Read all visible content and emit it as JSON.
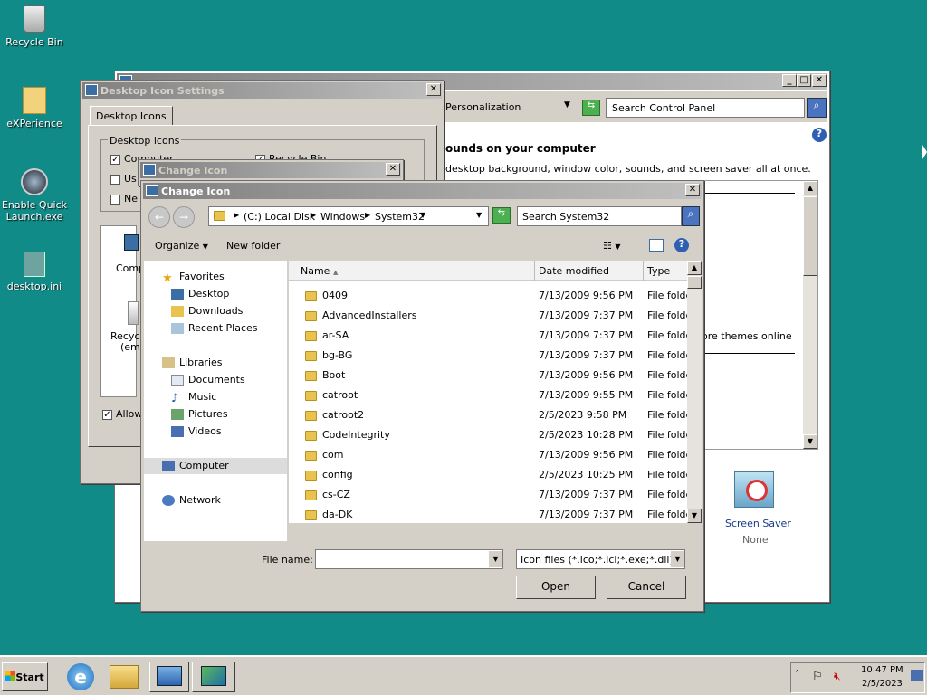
{
  "desktop": {
    "icons": [
      {
        "label": "Recycle Bin"
      },
      {
        "label": "eXPerience"
      },
      {
        "label": "Enable Quick Launch.exe"
      },
      {
        "label": "desktop.ini"
      }
    ]
  },
  "personalization": {
    "breadcrumb": "Personalization",
    "search_placeholder": "Search Control Panel",
    "heading": "ounds on your computer",
    "subtext": "desktop background, window color, sounds, and screen saver all at once.",
    "more_themes": "ore themes online",
    "screen_saver_label": "Screen Saver",
    "screen_saver_value": "None"
  },
  "desktop_icon_settings": {
    "title": "Desktop Icon Settings",
    "tab": "Desktop Icons",
    "group": "Desktop icons",
    "cb_computer": "Computer",
    "cb_recycle": "Recycle Bin",
    "cb_user": "Us",
    "cb_network": "Ne",
    "preview_computer": "Comp",
    "preview_recycle": "Recyc",
    "preview_recycle2": "(emp",
    "allow": "Allow"
  },
  "change_icon_back": {
    "title": "Change Icon"
  },
  "change_icon": {
    "title": "Change Icon",
    "path": [
      "(C:) Local Disk",
      "Windows",
      "System32"
    ],
    "search_placeholder": "Search System32",
    "organize": "Organize",
    "new_folder": "New folder",
    "nav": {
      "favorites": "Favorites",
      "desktop": "Desktop",
      "downloads": "Downloads",
      "recent": "Recent Places",
      "libraries": "Libraries",
      "documents": "Documents",
      "music": "Music",
      "pictures": "Pictures",
      "videos": "Videos",
      "computer": "Computer",
      "network": "Network"
    },
    "columns": {
      "name": "Name",
      "date": "Date modified",
      "type": "Type"
    },
    "files": [
      {
        "name": "0409",
        "date": "7/13/2009 9:56 PM",
        "type": "File folder"
      },
      {
        "name": "AdvancedInstallers",
        "date": "7/13/2009 7:37 PM",
        "type": "File folder"
      },
      {
        "name": "ar-SA",
        "date": "7/13/2009 7:37 PM",
        "type": "File folder"
      },
      {
        "name": "bg-BG",
        "date": "7/13/2009 7:37 PM",
        "type": "File folder"
      },
      {
        "name": "Boot",
        "date": "7/13/2009 9:56 PM",
        "type": "File folder"
      },
      {
        "name": "catroot",
        "date": "7/13/2009 9:55 PM",
        "type": "File folder"
      },
      {
        "name": "catroot2",
        "date": "2/5/2023 9:58 PM",
        "type": "File folder"
      },
      {
        "name": "CodeIntegrity",
        "date": "2/5/2023 10:28 PM",
        "type": "File folder"
      },
      {
        "name": "com",
        "date": "7/13/2009 9:56 PM",
        "type": "File folder"
      },
      {
        "name": "config",
        "date": "2/5/2023 10:25 PM",
        "type": "File folder"
      },
      {
        "name": "cs-CZ",
        "date": "7/13/2009 7:37 PM",
        "type": "File folder"
      },
      {
        "name": "da-DK",
        "date": "7/13/2009 7:37 PM",
        "type": "File folder"
      }
    ],
    "filename_label": "File name:",
    "filename_value": "",
    "filetype": "Icon files (*.ico;*.icl;*.exe;*.dll)",
    "open": "Open",
    "cancel": "Cancel"
  },
  "taskbar": {
    "start": "Start",
    "time": "10:47 PM",
    "date": "2/5/2023"
  }
}
